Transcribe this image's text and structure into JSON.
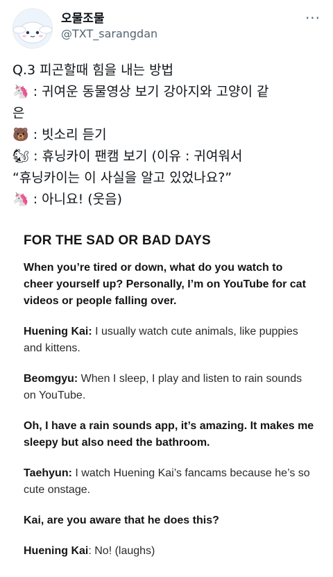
{
  "header": {
    "display_name": "오물조물",
    "handle": "@TXT_sarangdan",
    "more": "···"
  },
  "tweet_lines": [
    "Q.3 피곤할때 힘을 내는 방법",
    "🦄 : 귀여운 동물영상 보기 강아지와 고양이 같",
    "은",
    "🐻 : 빗소리 듣기",
    "🐿 : 휴닝카이 팬캠 보기 (이유 : 귀여워서",
    "“휴닝카이는 이 사실을 알고 있었나요?”",
    "🦄 : 아니요! (웃음)"
  ],
  "article": {
    "heading": "FOR THE SAD OR BAD DAYS",
    "q1": "When you’re tired or down, what do you watch to cheer yourself up? Personally, I’m on YouTube for cat videos or people falling over.",
    "a1_speaker": "Huening Kai:",
    "a1_text": " I usually watch cute animals, like puppies and kittens.",
    "a2_speaker": "Beomgyu:",
    "a2_text": " When I sleep, I play and listen to rain sounds on YouTube.",
    "q2": "Oh, I have a rain sounds app, it’s amazing. It makes me sleepy but also need the bathroom.",
    "a3_speaker": "Taehyun:",
    "a3_text": " I watch Huening Kai’s fancams because he’s so cute onstage.",
    "q3": "Kai, are you aware that he does this?",
    "a4_speaker": "Huening Kai",
    "a4_text": ": No! (laughs)"
  }
}
